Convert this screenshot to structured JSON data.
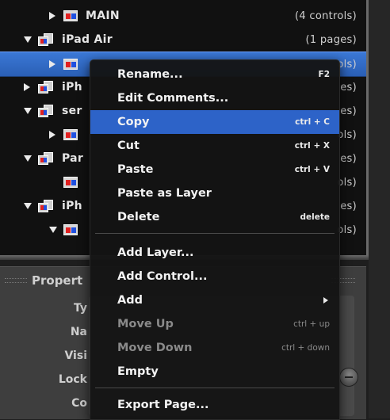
{
  "tree": {
    "rows": [
      {
        "label": "MAIN",
        "count": "(4 controls)"
      },
      {
        "label": "iPad Air",
        "count": "(1 pages)"
      },
      {
        "label": "",
        "count": "ols)"
      },
      {
        "label": "iPh",
        "count": "es)"
      },
      {
        "label": "ser",
        "count": "es)"
      },
      {
        "label": "",
        "count": "ols)"
      },
      {
        "label": "Par",
        "count": "es)"
      },
      {
        "label": "",
        "count": "ols)"
      },
      {
        "label": "iPh",
        "count": "es)"
      },
      {
        "label": "",
        "count": "ols)"
      }
    ]
  },
  "properties": {
    "title": "Propert",
    "labels": [
      "Ty",
      "Na",
      "Visi",
      "Lock",
      "Co"
    ]
  },
  "menu": {
    "items": [
      {
        "label": "Rename...",
        "shortcut": "F2"
      },
      {
        "label": "Edit Comments...",
        "shortcut": ""
      },
      {
        "label": "Copy",
        "shortcut": "ctrl + C"
      },
      {
        "label": "Cut",
        "shortcut": "ctrl + X"
      },
      {
        "label": "Paste",
        "shortcut": "ctrl + V"
      },
      {
        "label": "Paste as Layer",
        "shortcut": ""
      },
      {
        "label": "Delete",
        "shortcut": "delete"
      },
      {
        "label": "Add Layer...",
        "shortcut": ""
      },
      {
        "label": "Add Control...",
        "shortcut": ""
      },
      {
        "label": "Add",
        "shortcut": ""
      },
      {
        "label": "Move Up",
        "shortcut": "ctrl + up"
      },
      {
        "label": "Move Down",
        "shortcut": "ctrl + down"
      },
      {
        "label": "Empty",
        "shortcut": ""
      },
      {
        "label": "Export Page...",
        "shortcut": ""
      }
    ]
  },
  "colors": {
    "highlight": "#2d63c8",
    "selected_row": "#3b78d6"
  }
}
